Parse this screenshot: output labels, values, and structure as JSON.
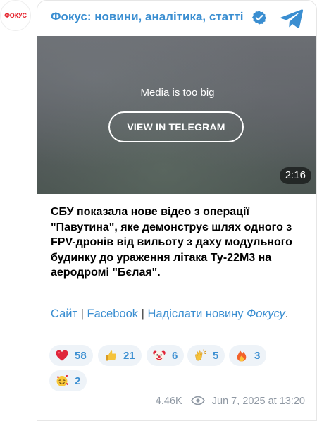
{
  "avatar": {
    "logo_text": "ФОКУС"
  },
  "header": {
    "channel_name": "Фокус: новини, аналітика, статті"
  },
  "media": {
    "message": "Media is too big",
    "button_label": "VIEW IN TELEGRAM",
    "duration": "2:16"
  },
  "post": {
    "text": "СБУ показала нове відео з операції \"Павутина\", яке демонструє шлях одного з FPV-дронів від вильоту з даху модульного будинку до ураження літака Ту-22М3 на аеродромі \"Бєлая\"."
  },
  "links": {
    "site": "Сайт",
    "sep1": " | ",
    "facebook": "Facebook",
    "sep2": " | ",
    "submit_prefix": "Надіслати новину ",
    "submit_italic": "Фокусу",
    "period": "."
  },
  "reactions": [
    {
      "icon": "red-heart-icon",
      "count": "58"
    },
    {
      "icon": "thumbs-up-icon",
      "count": "21"
    },
    {
      "icon": "clown-face-icon",
      "count": "6"
    },
    {
      "icon": "clapping-hands-icon",
      "count": "5"
    },
    {
      "icon": "fire-icon",
      "count": "3"
    },
    {
      "icon": "smiling-face-with-hearts-icon",
      "count": "2"
    }
  ],
  "meta": {
    "views": "4.46K",
    "date": "Jun 7, 2025 at 13:20"
  },
  "colors": {
    "accent": "#3a8ed1",
    "brand_red": "#e5202a",
    "reaction_bg": "#eef3f8",
    "meta_gray": "#8f98a3"
  }
}
